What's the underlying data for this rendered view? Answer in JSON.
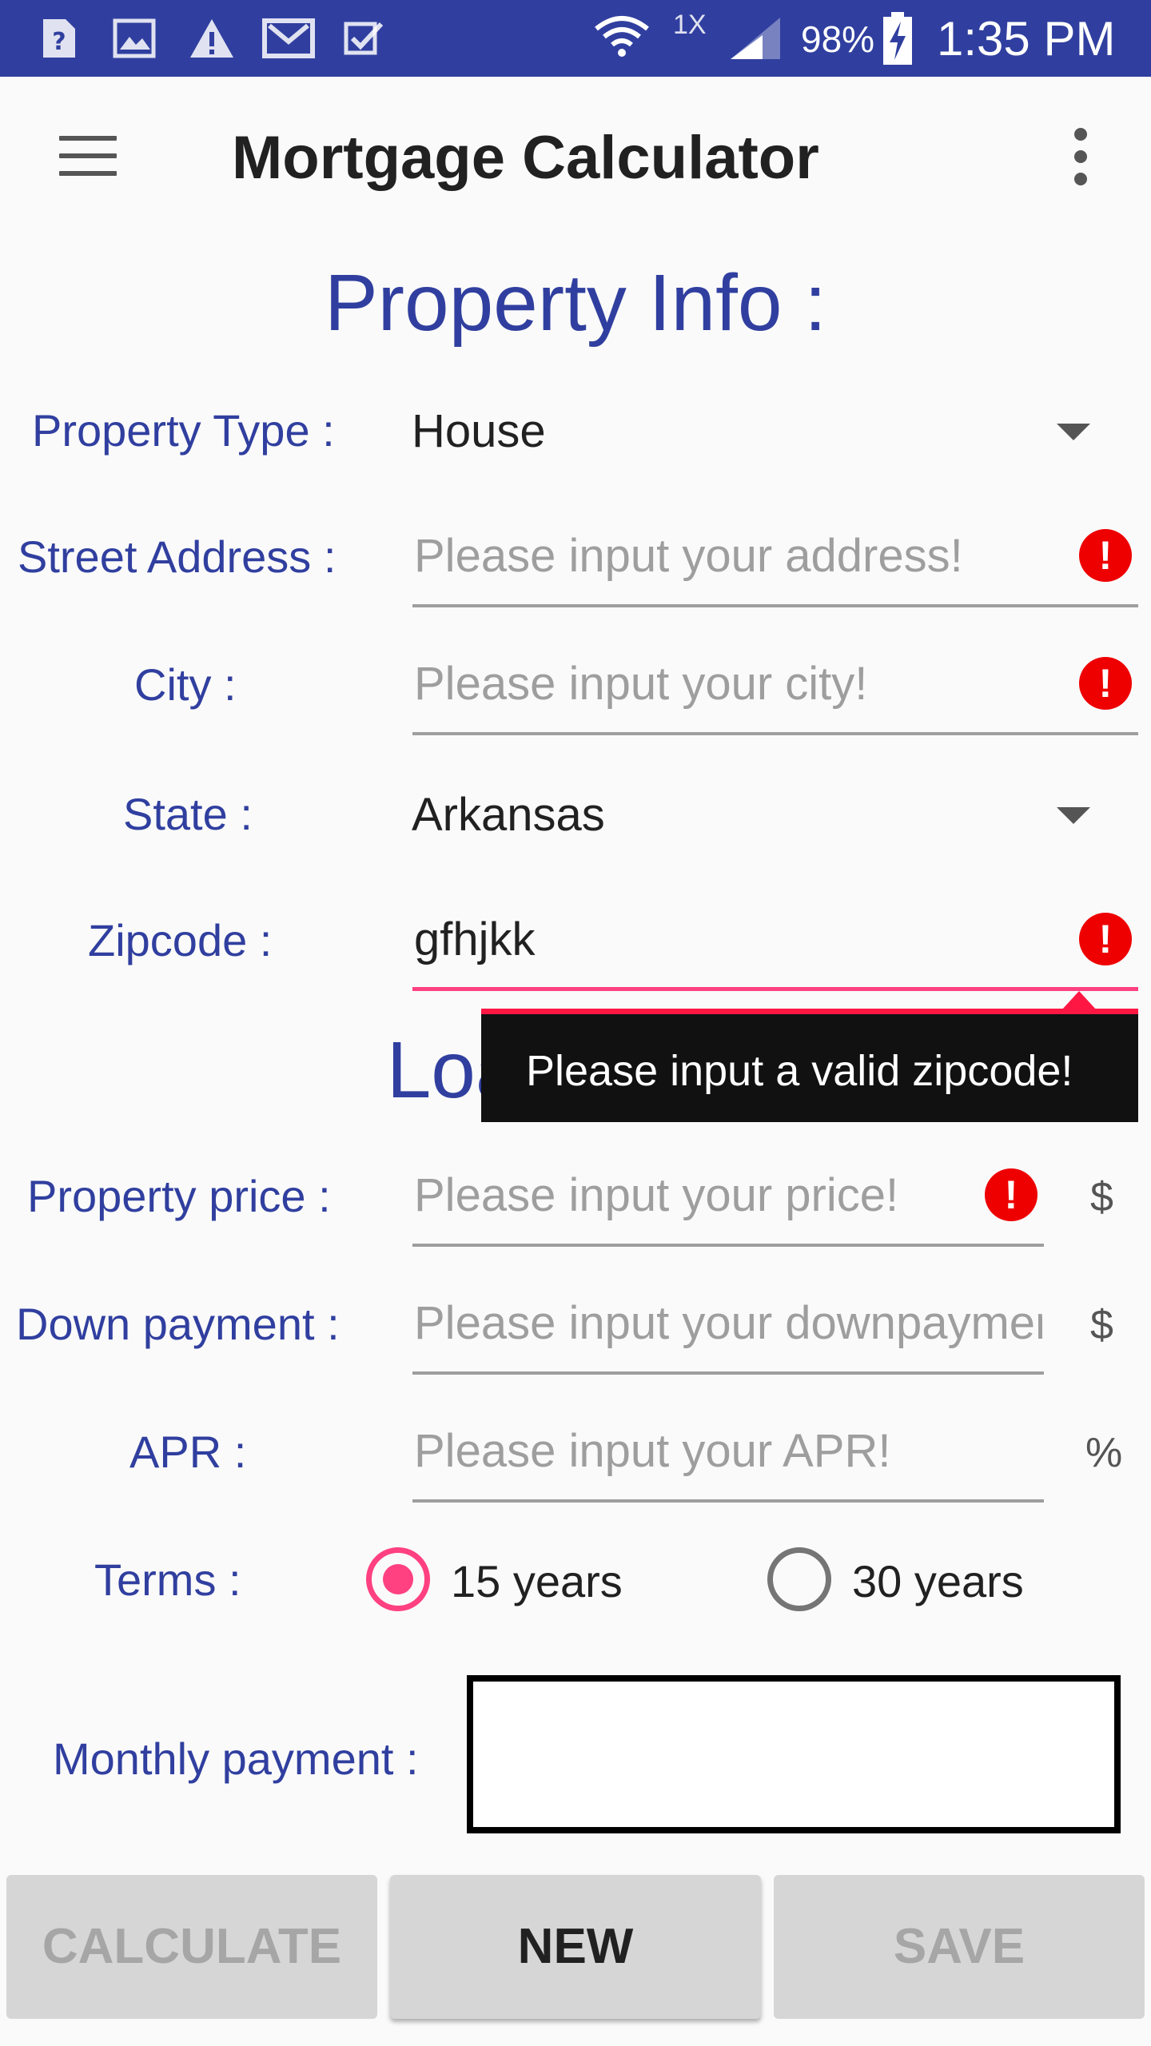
{
  "status_bar": {
    "network_label": "1X",
    "battery": "98%",
    "time": "1:35 PM"
  },
  "app_bar": {
    "title": "Mortgage Calculator"
  },
  "property_section": {
    "title": "Property Info :",
    "property_type_label": "Property Type :",
    "property_type_value": "House",
    "street_label": "Street Address :",
    "street_placeholder": "Please input your address!",
    "city_label": "City :",
    "city_placeholder": "Please input your city!",
    "state_label": "State :",
    "state_value": "Arkansas",
    "zipcode_label": "Zipcode :",
    "zipcode_value": "gfhjkk",
    "zipcode_error": "Please input a valid zipcode!"
  },
  "loan_section": {
    "title": "Loan Info :",
    "price_label": "Property price :",
    "price_placeholder": "Please input your price!",
    "price_unit": "$",
    "down_label": "Down payment :",
    "down_placeholder": "Please input your downpayment!",
    "down_unit": "$",
    "apr_label": "APR :",
    "apr_placeholder": "Please input your APR!",
    "apr_unit": "%",
    "terms_label": "Terms :",
    "term_options": [
      "15 years",
      "30 years"
    ],
    "selected_term": "15 years",
    "monthly_label": "Monthly payment :"
  },
  "buttons": {
    "calculate": "CALCULATE",
    "new": "NEW",
    "save": "SAVE"
  },
  "colors": {
    "primary": "#303f9f",
    "accent": "#ff4081",
    "error": "#ee0000"
  }
}
